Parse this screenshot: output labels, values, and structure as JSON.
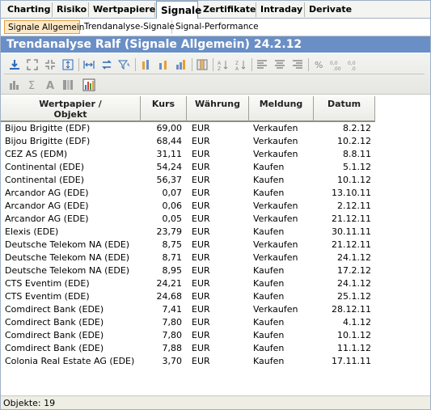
{
  "tabs": [
    "Charting",
    "Risiko",
    "Wertpapiere",
    "Signale",
    "Zertifikate",
    "Intraday",
    "Derivate"
  ],
  "active_tab": "Signale",
  "subtabs": [
    "Signale Allgemein",
    "Trendanalyse-Signale",
    "Signal-Performance"
  ],
  "active_subtab": "Signale Allgemein",
  "title": "Trendanalyse Ralf (Signale Allgemein) 24.2.12",
  "columns": {
    "wertpapier_line1": "Wertpapier /",
    "wertpapier_line2": "Objekt",
    "kurs": "Kurs",
    "waehrung": "Währung",
    "meldung": "Meldung",
    "datum": "Datum"
  },
  "rows": [
    {
      "name": "Bijou Brigitte (EDF)",
      "kurs": "69,00",
      "waehrung": "EUR",
      "meldung": "Verkaufen",
      "datum": "8.2.12"
    },
    {
      "name": "Bijou Brigitte (EDF)",
      "kurs": "68,44",
      "waehrung": "EUR",
      "meldung": "Verkaufen",
      "datum": "10.2.12"
    },
    {
      "name": "CEZ AS (EDM)",
      "kurs": "31,11",
      "waehrung": "EUR",
      "meldung": "Verkaufen",
      "datum": "8.8.11"
    },
    {
      "name": "Continental (EDE)",
      "kurs": "54,24",
      "waehrung": "EUR",
      "meldung": "Kaufen",
      "datum": "5.1.12"
    },
    {
      "name": "Continental (EDE)",
      "kurs": "56,37",
      "waehrung": "EUR",
      "meldung": "Kaufen",
      "datum": "10.1.12"
    },
    {
      "name": "Arcandor AG (EDE)",
      "kurs": "0,07",
      "waehrung": "EUR",
      "meldung": "Kaufen",
      "datum": "13.10.11"
    },
    {
      "name": "Arcandor AG (EDE)",
      "kurs": "0,06",
      "waehrung": "EUR",
      "meldung": "Verkaufen",
      "datum": "2.12.11"
    },
    {
      "name": "Arcandor AG (EDE)",
      "kurs": "0,05",
      "waehrung": "EUR",
      "meldung": "Verkaufen",
      "datum": "21.12.11"
    },
    {
      "name": "Elexis (EDE)",
      "kurs": "23,79",
      "waehrung": "EUR",
      "meldung": "Kaufen",
      "datum": "30.11.11"
    },
    {
      "name": "Deutsche Telekom NA (EDE)",
      "kurs": "8,75",
      "waehrung": "EUR",
      "meldung": "Verkaufen",
      "datum": "21.12.11"
    },
    {
      "name": "Deutsche Telekom NA (EDE)",
      "kurs": "8,71",
      "waehrung": "EUR",
      "meldung": "Verkaufen",
      "datum": "24.1.12"
    },
    {
      "name": "Deutsche Telekom NA (EDE)",
      "kurs": "8,95",
      "waehrung": "EUR",
      "meldung": "Kaufen",
      "datum": "17.2.12"
    },
    {
      "name": "CTS Eventim (EDE)",
      "kurs": "24,21",
      "waehrung": "EUR",
      "meldung": "Kaufen",
      "datum": "24.1.12"
    },
    {
      "name": "CTS Eventim (EDE)",
      "kurs": "24,68",
      "waehrung": "EUR",
      "meldung": "Kaufen",
      "datum": "25.1.12"
    },
    {
      "name": "Comdirect Bank (EDE)",
      "kurs": "7,41",
      "waehrung": "EUR",
      "meldung": "Verkaufen",
      "datum": "28.12.11"
    },
    {
      "name": "Comdirect Bank (EDE)",
      "kurs": "7,80",
      "waehrung": "EUR",
      "meldung": "Kaufen",
      "datum": "4.1.12"
    },
    {
      "name": "Comdirect Bank (EDE)",
      "kurs": "7,80",
      "waehrung": "EUR",
      "meldung": "Kaufen",
      "datum": "10.1.12"
    },
    {
      "name": "Comdirect Bank (EDE)",
      "kurs": "7,88",
      "waehrung": "EUR",
      "meldung": "Kaufen",
      "datum": "11.1.12"
    },
    {
      "name": "Colonia Real Estate AG (EDE)",
      "kurs": "3,70",
      "waehrung": "EUR",
      "meldung": "Kaufen",
      "datum": "17.11.11"
    }
  ],
  "status": "Objekte: 19",
  "toolbar": {
    "row1": [
      "export-icon",
      "expand-icon",
      "collapse-icon",
      "fit-height-icon",
      "fit-width-icon",
      "swap-icon",
      "filter-icon",
      "bar-left-icon",
      "bar-center-icon",
      "bar-chart-icon",
      "grid-icon",
      "sort-ascending-icon",
      "sort-descending-icon",
      "align-left-icon",
      "align-center-icon",
      "align-right-icon",
      "percent-icon",
      "decimal-increase-icon",
      "decimal-decrease-icon"
    ],
    "row2": [
      "column-chart-icon",
      "sum-icon",
      "font-icon",
      "column-layout-icon",
      "chart-icon"
    ]
  },
  "colors": {
    "title_bar": "#6a8fc6",
    "active_subtab_bg": "#fde9c8",
    "status_bar": "#efeee5"
  }
}
